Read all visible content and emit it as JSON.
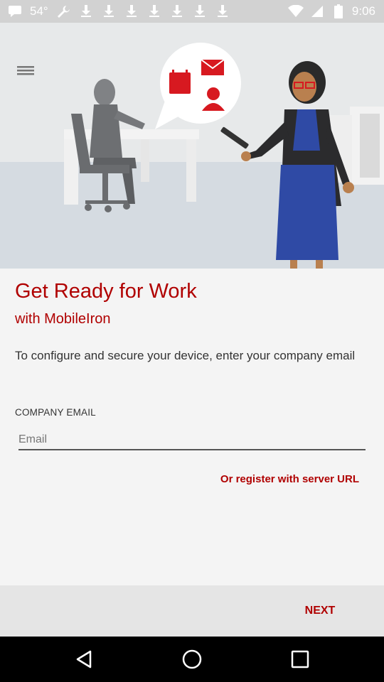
{
  "status_bar": {
    "temperature": "54°",
    "time": "9:06",
    "left_icons": [
      "chat-icon",
      "wrench-icon",
      "download-icon",
      "download-icon",
      "download-icon",
      "download-icon",
      "download-icon",
      "download-icon",
      "download-icon"
    ],
    "right_icons": [
      "wifi-icon",
      "signal-icon",
      "battery-icon"
    ]
  },
  "main": {
    "title": "Get Ready for Work",
    "subtitle": "with MobileIron",
    "description": "To configure and secure your device, enter your company email",
    "email_label": "COMPANY EMAIL",
    "email_value": "",
    "email_placeholder": "Email",
    "register_link": "Or register with server URL"
  },
  "footer": {
    "next_label": "NEXT"
  },
  "colors": {
    "accent": "#b00000",
    "background": "#f4f4f4",
    "hero_background": "#e7e9ea"
  }
}
